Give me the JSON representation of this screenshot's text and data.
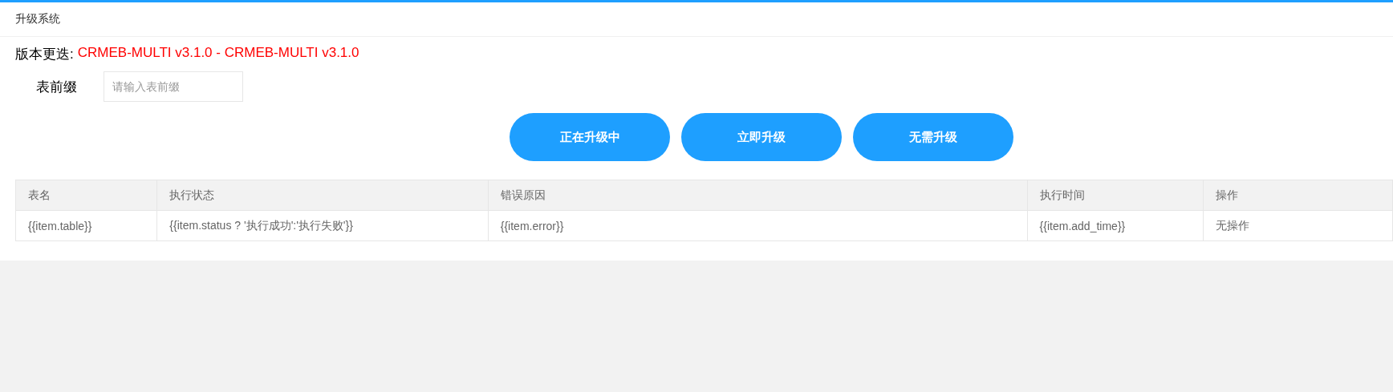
{
  "header": {
    "title": "升级系统"
  },
  "version": {
    "label": "版本更迭:",
    "value": "CRMEB-MULTI v3.1.0 - CRMEB-MULTI v3.1.0"
  },
  "prefix_field": {
    "label": "表前缀",
    "placeholder": "请输入表前缀"
  },
  "buttons": [
    "正在升级中",
    "立即升级",
    "无需升级"
  ],
  "table": {
    "columns": [
      "表名",
      "执行状态",
      "错误原因",
      "执行时间",
      "操作"
    ],
    "rows": [
      [
        "{{item.table}}",
        "{{item.status ? '执行成功':'执行失败'}}",
        "{{item.error}}",
        "{{item.add_time}}",
        "无操作"
      ]
    ]
  }
}
